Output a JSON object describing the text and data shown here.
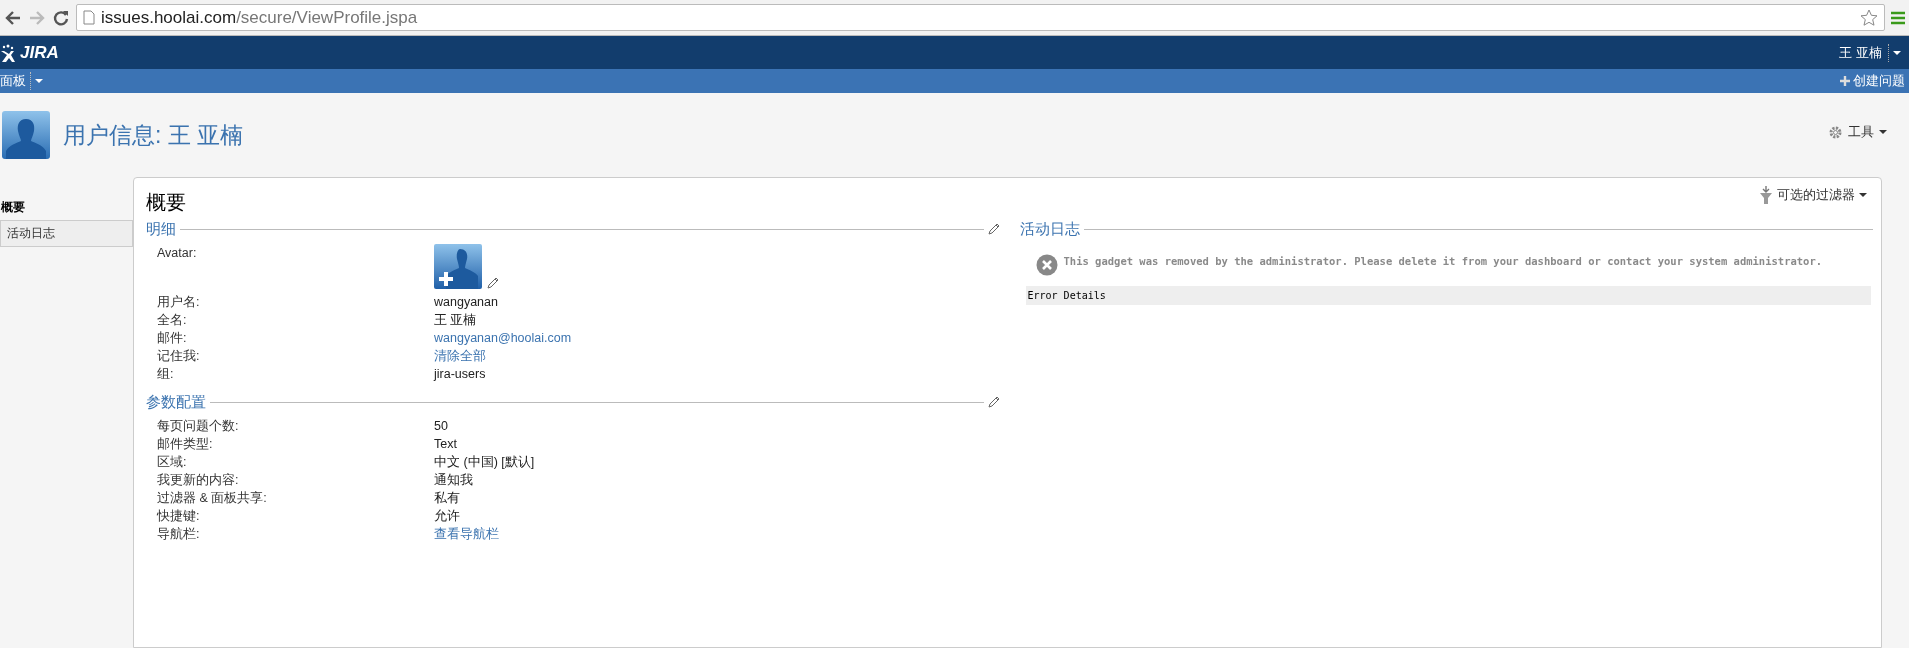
{
  "browser": {
    "url_host": "issues.hoolai.com",
    "url_path": "/secure/ViewProfile.jspa"
  },
  "header": {
    "logo": "JIRA",
    "user": "王 亚楠"
  },
  "nav": {
    "menu": "面板",
    "create": "创建问题"
  },
  "profile": {
    "title": "用户信息: 王 亚楠",
    "tools": "工具"
  },
  "sidebar": {
    "items": [
      {
        "label": "概要",
        "selected": true
      },
      {
        "label": "活动日志",
        "selected": false
      }
    ]
  },
  "panel": {
    "heading": "概要",
    "filter": "可选的过滤器",
    "details": {
      "title": "明细",
      "rows": [
        {
          "label": "Avatar:",
          "kind": "avatar"
        },
        {
          "label": "用户名:",
          "value": "wangyanan",
          "kind": "text"
        },
        {
          "label": "全名:",
          "value": "王 亚楠",
          "kind": "text"
        },
        {
          "label": "邮件:",
          "value": "wangyanan@hoolai.com",
          "kind": "link"
        },
        {
          "label": "记住我:",
          "value": "清除全部",
          "kind": "link"
        },
        {
          "label": "组:",
          "value": "jira-users",
          "kind": "text"
        }
      ]
    },
    "preferences": {
      "title": "参数配置",
      "rows": [
        {
          "label": "每页问题个数:",
          "value": "50",
          "kind": "text"
        },
        {
          "label": "邮件类型:",
          "value": "Text",
          "kind": "text"
        },
        {
          "label": "区域:",
          "value": "中文 (中国) [默认]",
          "kind": "text"
        },
        {
          "label": "我更新的内容:",
          "value": "通知我",
          "kind": "text"
        },
        {
          "label": "过滤器 & 面板共享:",
          "value": "私有",
          "kind": "text"
        },
        {
          "label": "快捷键:",
          "value": "允许",
          "kind": "text"
        },
        {
          "label": "导航栏:",
          "value": "查看导航栏",
          "kind": "link"
        }
      ]
    },
    "activity": {
      "title": "活动日志",
      "error": "This gadget was removed by the administrator. Please delete it from your dashboard or contact your system administrator.",
      "error_details": "Error Details"
    }
  }
}
